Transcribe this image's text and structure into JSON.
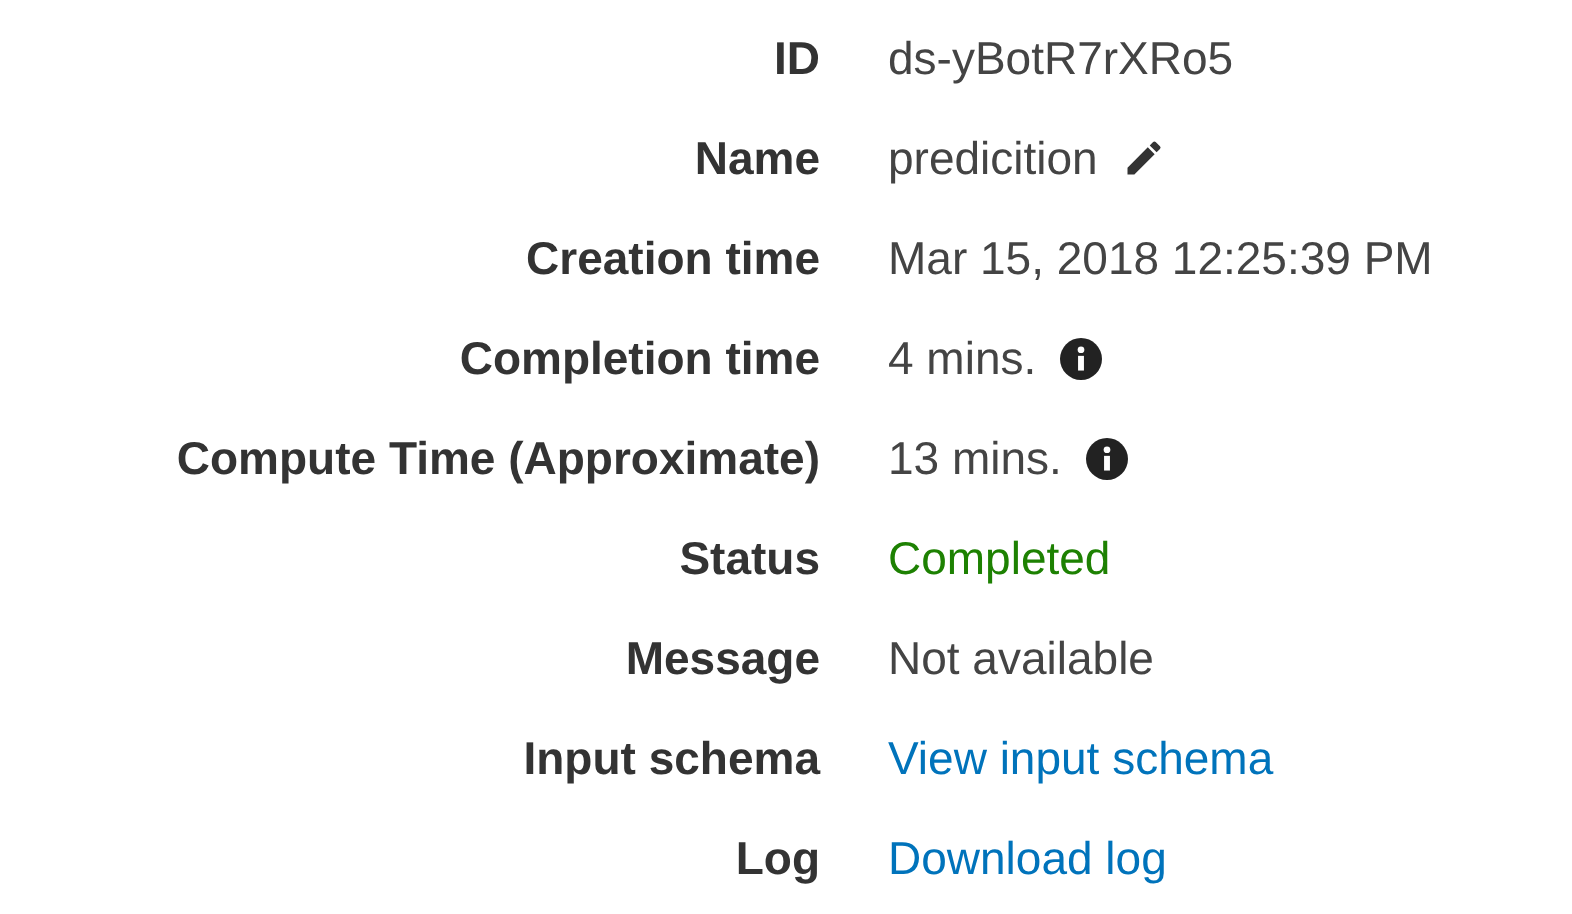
{
  "details": [
    {
      "label": "ID",
      "value": "ds-yBotR7rXRo5",
      "kind": "text"
    },
    {
      "label": "Name",
      "value": "predicition",
      "kind": "editable"
    },
    {
      "label": "Creation time",
      "value": "Mar 15, 2018 12:25:39 PM",
      "kind": "text"
    },
    {
      "label": "Completion time",
      "value": "4 mins.",
      "kind": "info"
    },
    {
      "label": "Compute Time (Approximate)",
      "value": "13 mins.",
      "kind": "info"
    },
    {
      "label": "Status",
      "value": "Completed",
      "kind": "status"
    },
    {
      "label": "Message",
      "value": "Not available",
      "kind": "text"
    },
    {
      "label": "Input schema",
      "value": "View input schema",
      "kind": "link"
    },
    {
      "label": "Log",
      "value": "Download log",
      "kind": "link"
    }
  ]
}
